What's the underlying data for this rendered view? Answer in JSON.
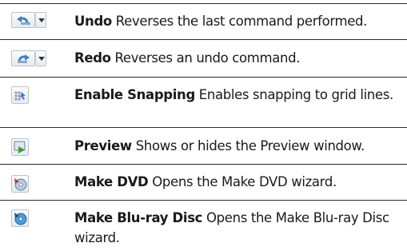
{
  "rows": [
    {
      "title": "Undo",
      "description": " Reverses the last command performed.",
      "icon": "undo-arrow-icon"
    },
    {
      "title": "Redo",
      "description": " Reverses an undo command.",
      "icon": "redo-arrow-icon"
    },
    {
      "title": "Enable Snapping",
      "description": " Enables snapping to grid lines.",
      "icon": "snap-grid-icon"
    },
    {
      "title": "Preview",
      "description": " Shows or hides the Preview window.",
      "icon": "preview-play-icon"
    },
    {
      "title": "Make DVD",
      "description": " Opens the Make DVD wizard.",
      "icon": "dvd-disc-icon"
    },
    {
      "title": "Make Blu-ray Disc",
      "description": " Opens the Make Blu-ray Disc wizard.",
      "icon": "bluray-disc-icon"
    }
  ],
  "colors": {
    "rule": "#2b2b2b",
    "button_border": "#b9c4d1",
    "icon_blue": "#3f7fc4",
    "icon_red": "#c8342a",
    "icon_green": "#37a03a"
  }
}
